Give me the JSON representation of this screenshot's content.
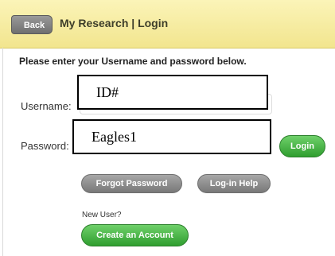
{
  "header": {
    "back_label": "Back",
    "title": "My Research | Login"
  },
  "form": {
    "instructions": "Please enter your Username and password below.",
    "username_label": "Username:",
    "username_value": "ID#",
    "password_label": "Password:",
    "password_value": "Eagles1",
    "login_label": "Login"
  },
  "links": {
    "forgot_password": "Forgot Password",
    "login_help": "Log-in Help",
    "new_user": "New User?",
    "create_account": "Create an Account"
  },
  "colors": {
    "header_bg": "#f2e58e",
    "primary_button": "#2f9e2f",
    "secondary_button": "#787878"
  }
}
